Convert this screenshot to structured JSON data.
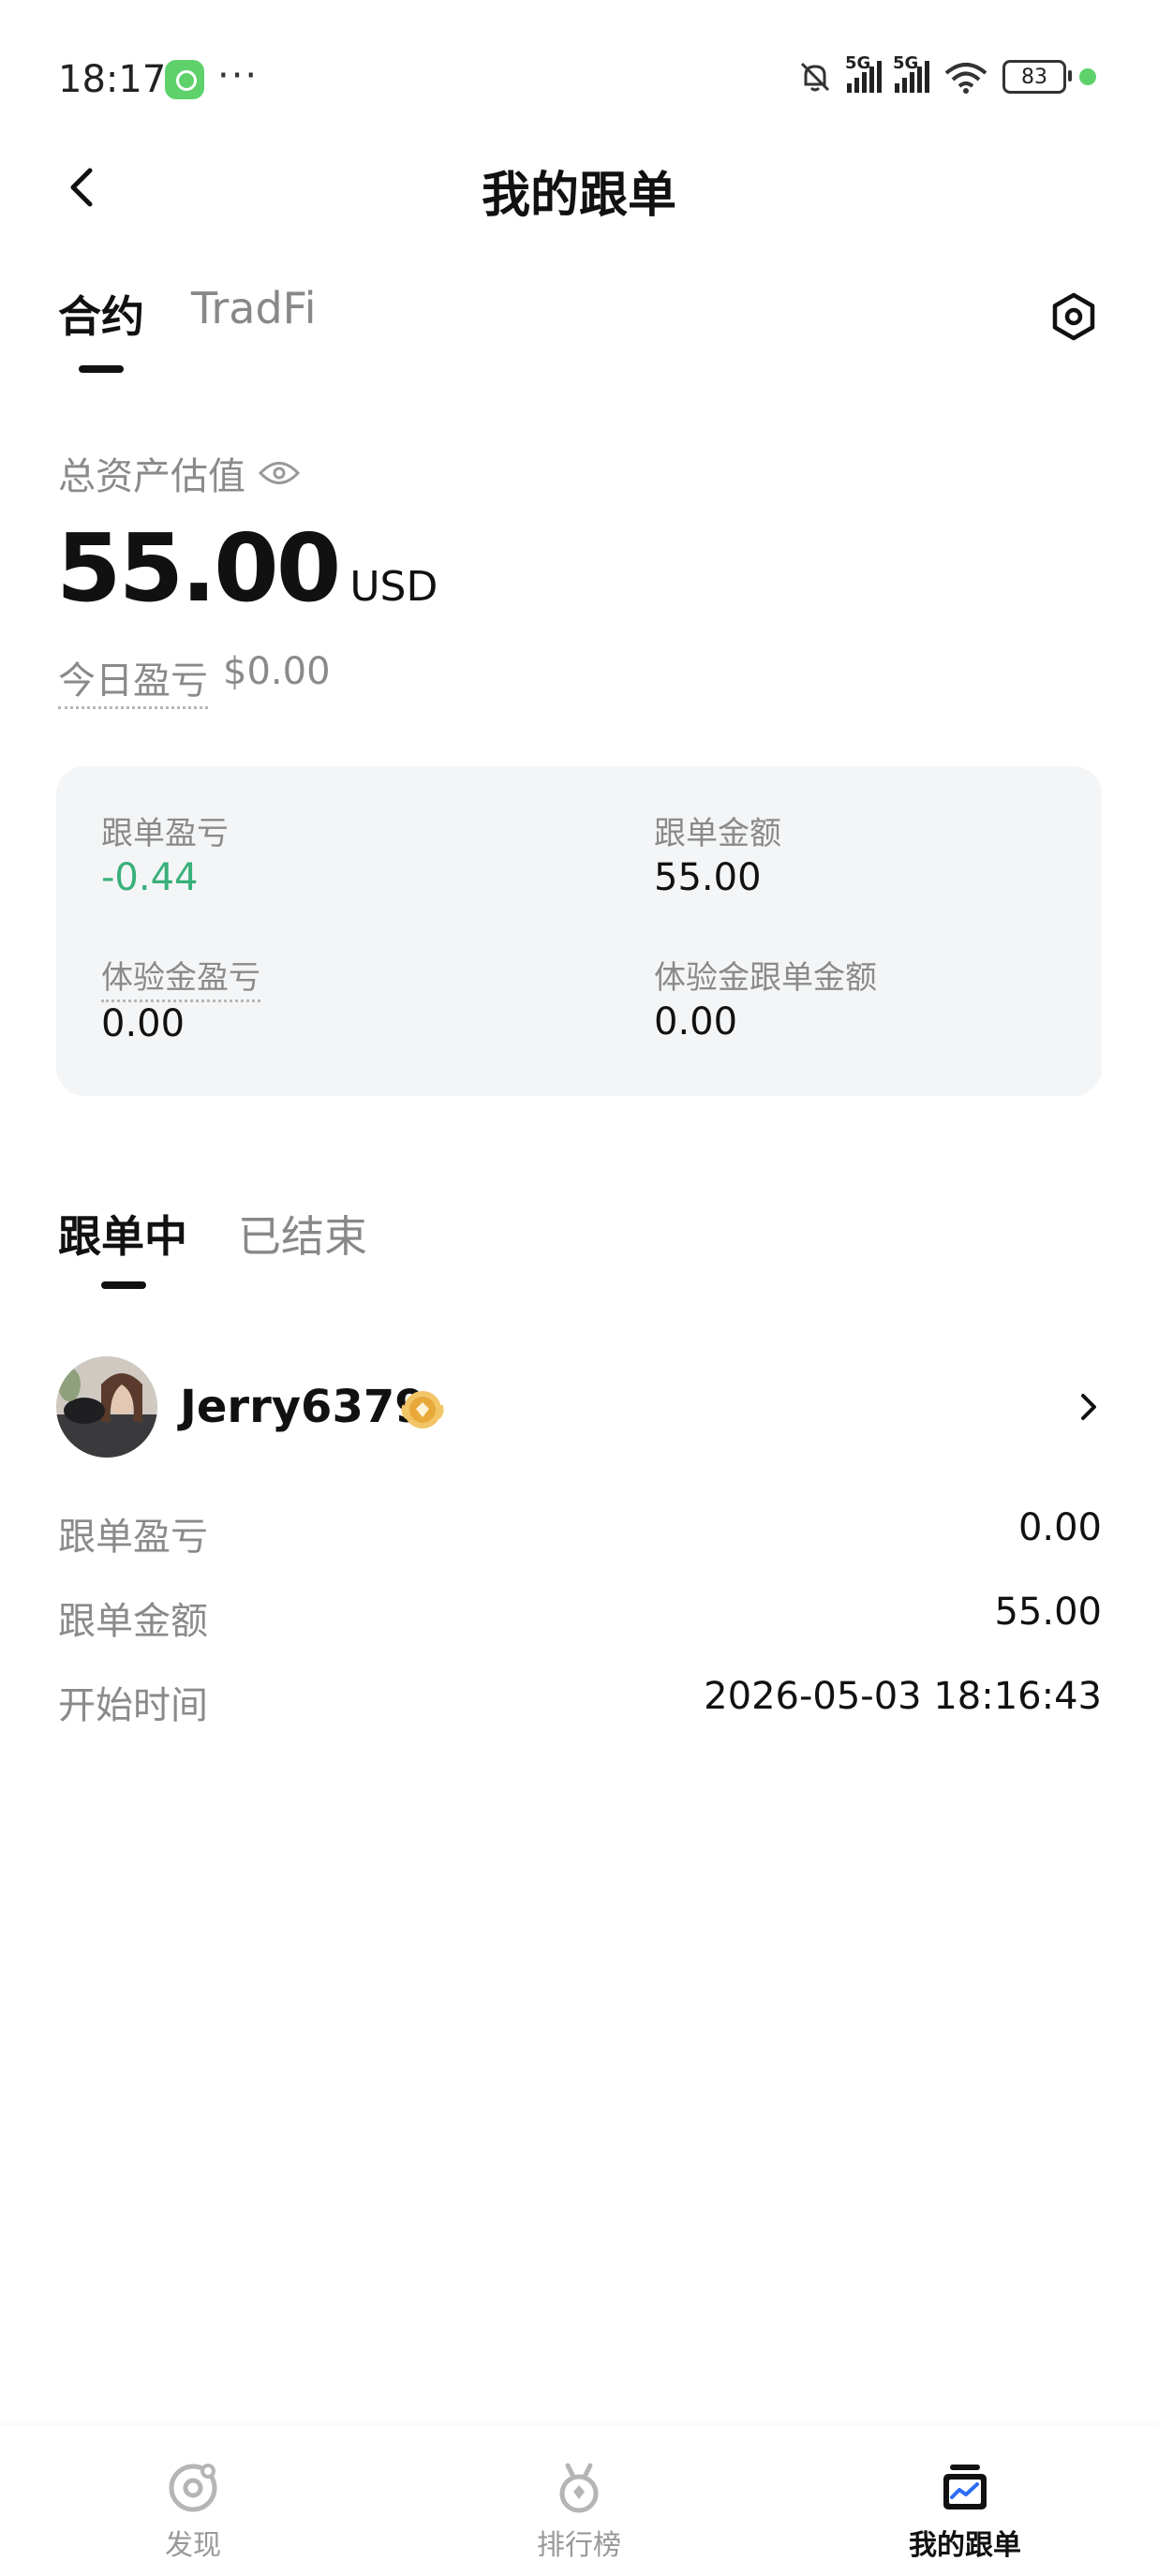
{
  "status_bar": {
    "time": "18:17",
    "dots": "···",
    "signal_1": "5G",
    "signal_2": "5G",
    "battery": "83"
  },
  "header": {
    "title": "我的跟单"
  },
  "top_tabs": [
    {
      "label": "合约",
      "active": true
    },
    {
      "label": "TradFi",
      "active": false
    }
  ],
  "assets": {
    "label": "总资产估值",
    "value": "55.00",
    "unit": "USD",
    "today_label": "今日盈亏",
    "today_value": "$0.00"
  },
  "summary": {
    "copy_pnl_label": "跟单盈亏",
    "copy_pnl_value": "-0.44",
    "copy_amount_label": "跟单金额",
    "copy_amount_value": "55.00",
    "trial_pnl_label": "体验金盈亏",
    "trial_pnl_value": "0.00",
    "trial_amount_label": "体验金跟单金额",
    "trial_amount_value": "0.00"
  },
  "follow_tabs": [
    {
      "label": "跟单中",
      "active": true
    },
    {
      "label": "已结束",
      "active": false
    }
  ],
  "trader": {
    "name": "Jerry6379",
    "rows": [
      {
        "label": "跟单盈亏",
        "value": "0.00"
      },
      {
        "label": "跟单金额",
        "value": "55.00"
      },
      {
        "label": "开始时间",
        "value": "2026-05-03 18:16:43"
      }
    ]
  },
  "bottom_nav": [
    {
      "label": "发现",
      "icon": "discover-icon",
      "active": false
    },
    {
      "label": "排行榜",
      "icon": "leaderboard-icon",
      "active": false
    },
    {
      "label": "我的跟单",
      "icon": "my-copy-trading-icon",
      "active": true
    }
  ],
  "colors": {
    "profit_green": "#39b07a",
    "card_bg": "#f4f5f6",
    "accent_blue": "#2b6cf6"
  }
}
